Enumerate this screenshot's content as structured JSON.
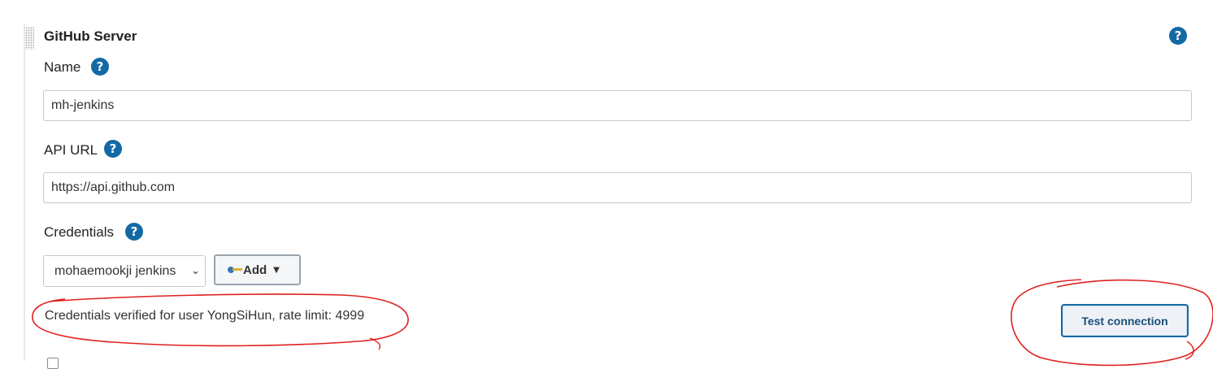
{
  "section": {
    "title": "GitHub Server"
  },
  "name_field": {
    "label": "Name",
    "value": "mh-jenkins"
  },
  "api_url_field": {
    "label": "API URL",
    "value": "https://api.github.com"
  },
  "credentials_field": {
    "label": "Credentials",
    "selected": "mohaemookji jenkins",
    "add_label": "Add"
  },
  "status": {
    "message": "Credentials verified for user YongSiHun, rate limit: 4999"
  },
  "actions": {
    "test_connection_label": "Test connection"
  },
  "help_icon": "?",
  "colors": {
    "help_icon": "#1369a4",
    "annotation": "#e02020",
    "button_border": "#1369a4"
  }
}
